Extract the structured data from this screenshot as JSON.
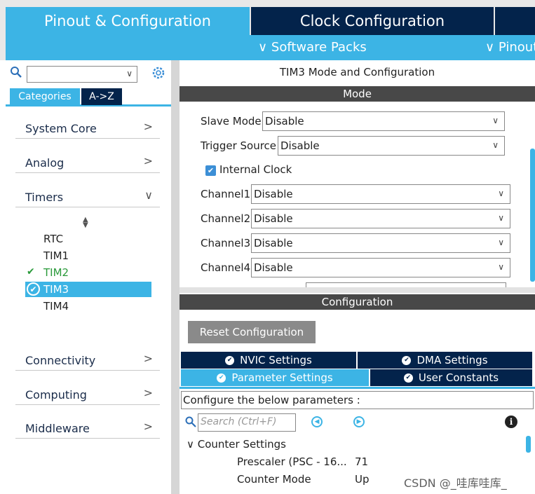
{
  "header": {
    "tabs": [
      "Pinout & Configuration",
      "Clock Configuration"
    ],
    "sub_items": [
      "Software Packs",
      "Pinout"
    ]
  },
  "sidebar": {
    "search_value": "",
    "category_tabs": [
      "Categories",
      "A->Z"
    ],
    "categories": [
      "System Core",
      "Analog",
      "Timers",
      "Connectivity",
      "Computing",
      "Middleware"
    ],
    "timers": [
      "RTC",
      "TIM1",
      "TIM2",
      "TIM3",
      "TIM4"
    ]
  },
  "mode": {
    "title": "TIM3 Mode and Configuration",
    "section": "Mode",
    "slave_mode_label": "Slave Mode",
    "slave_mode_value": "Disable",
    "trigger_source_label": "Trigger Source",
    "trigger_source_value": "Disable",
    "internal_clock_label": "Internal Clock",
    "internal_clock_checked": true,
    "channels": [
      {
        "label": "Channel1",
        "value": "Disable"
      },
      {
        "label": "Channel2",
        "value": "Disable"
      },
      {
        "label": "Channel3",
        "value": "Disable"
      },
      {
        "label": "Channel4",
        "value": "Disable"
      }
    ]
  },
  "config": {
    "section": "Configuration",
    "reset_label": "Reset Configuration",
    "tabs": [
      "NVIC Settings",
      "DMA Settings",
      "Parameter Settings",
      "User Constants"
    ],
    "hint": "Configure the below parameters :",
    "search_placeholder": "Search (Ctrl+F)",
    "group": "Counter Settings",
    "params": [
      {
        "name": "Prescaler (PSC - 16...",
        "value": "71"
      },
      {
        "name": "Counter Mode",
        "value": "Up"
      }
    ]
  },
  "watermark": "CSDN @_哇库哇库_",
  "colors": {
    "accent": "#3cb4e5",
    "dark": "#03234b",
    "ok": "#2a9a3a"
  }
}
